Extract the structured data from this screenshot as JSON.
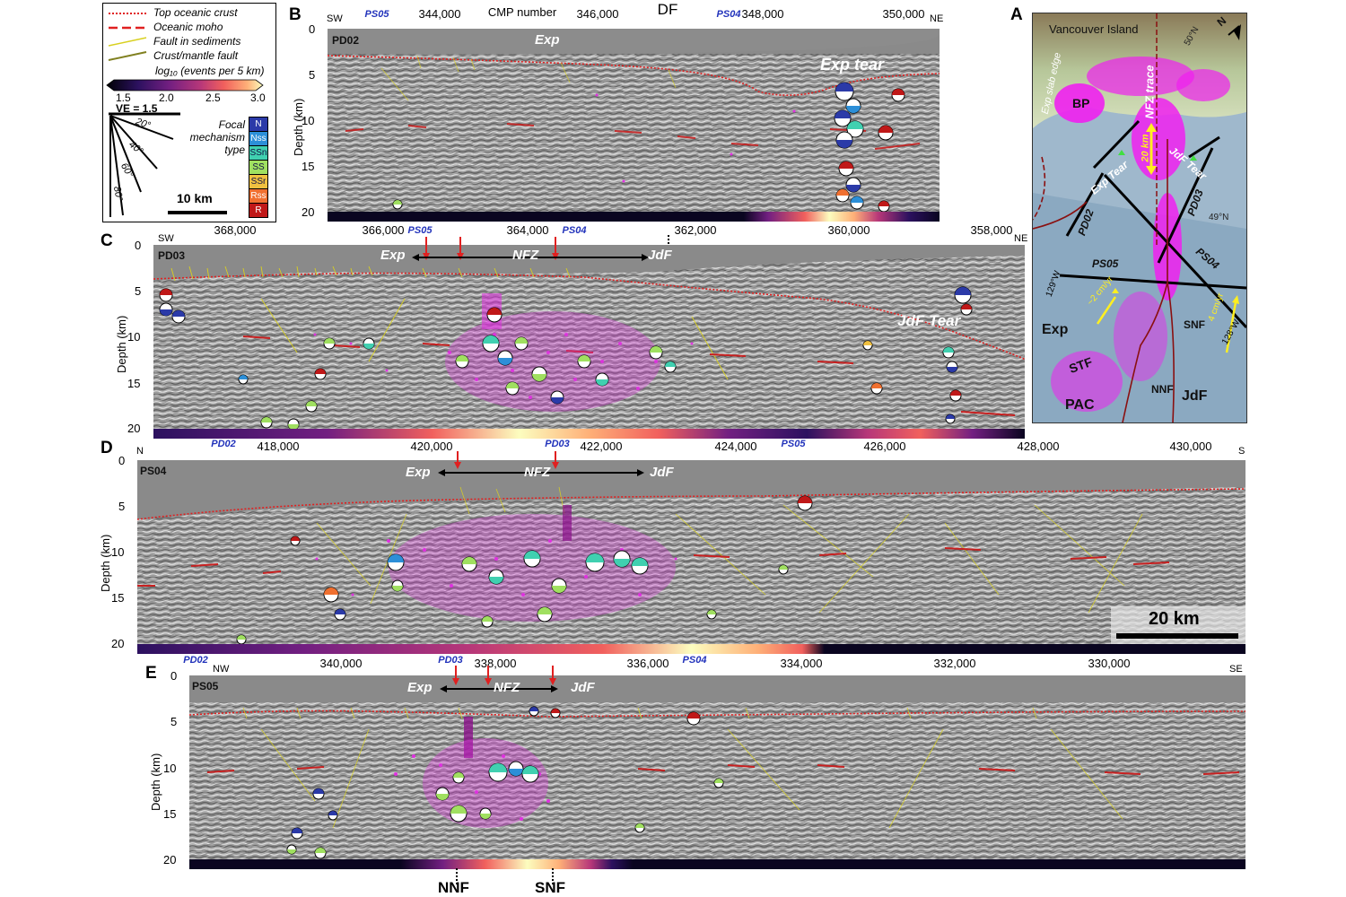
{
  "legend": {
    "items": [
      {
        "label": "Top oceanic crust",
        "color": "#e02020",
        "style": "dotted"
      },
      {
        "label": "Oceanic moho",
        "color": "#e02020",
        "style": "dashed"
      },
      {
        "label": "Fault in sediments",
        "color": "#d8d020",
        "style": "solid"
      },
      {
        "label": "Crust/mantle fault",
        "color": "#808020",
        "style": "solid"
      }
    ],
    "colorbar_title": "log₁₀ (events per 5 km)",
    "colorbar_ticks": [
      "1.5",
      "2.0",
      "2.5",
      "3.0"
    ],
    "ve_label": "VE = 1.5",
    "angle_labels": [
      "20°",
      "40°",
      "60°",
      "80°"
    ],
    "scale_label": "10 km",
    "focal_title": "Focal mechanism type",
    "focal_types": [
      {
        "code": "N",
        "color": "#2b3aa8"
      },
      {
        "code": "Nss",
        "color": "#2c8fd8"
      },
      {
        "code": "SSn",
        "color": "#40d0b0"
      },
      {
        "code": "SS",
        "color": "#a0e060"
      },
      {
        "code": "SSr",
        "color": "#f0c040"
      },
      {
        "code": "Rss",
        "color": "#f07030"
      },
      {
        "code": "R",
        "color": "#c01818"
      }
    ]
  },
  "panelB": {
    "letter": "B",
    "name": "PD02",
    "axis_title": "CMP number",
    "dir_left": "SW",
    "dir_right": "NE",
    "ticks": [
      "344,000",
      "346,000",
      "348,000",
      "350,000"
    ],
    "crossings": [
      "PS05",
      "PS04"
    ],
    "df_label": "DF",
    "labels": [
      "Exp",
      "Exp tear"
    ],
    "depth_ticks": [
      "0",
      "5",
      "10",
      "15",
      "20"
    ],
    "ylabel": "Depth (km)"
  },
  "panelC": {
    "letter": "C",
    "name": "PD03",
    "dir_left": "SW",
    "dir_right": "NE",
    "ticks": [
      "368,000",
      "366,000",
      "364,000",
      "362,000",
      "360,000",
      "358,000"
    ],
    "crossings": [
      "PS05",
      "PS04"
    ],
    "labels": [
      "Exp",
      "NFZ",
      "JdF",
      "JdF Tear"
    ],
    "depth_ticks": [
      "0",
      "5",
      "10",
      "15",
      "20"
    ],
    "ylabel": "Depth (km)"
  },
  "panelD": {
    "letter": "D",
    "name": "PS04",
    "dir_left": "N",
    "dir_right": "S",
    "ticks": [
      "418,000",
      "420,000",
      "422,000",
      "424,000",
      "426,000",
      "428,000",
      "430,000"
    ],
    "crossings": [
      "PD02",
      "PD03",
      "PS05"
    ],
    "labels": [
      "Exp",
      "NFZ",
      "JdF"
    ],
    "scale_label": "20 km",
    "depth_ticks": [
      "0",
      "5",
      "10",
      "15",
      "20"
    ],
    "ylabel": "Depth (km)"
  },
  "panelE": {
    "letter": "E",
    "name": "PS05",
    "dir_left": "NW",
    "dir_right": "SE",
    "ticks": [
      "340,000",
      "338,000",
      "336,000",
      "334,000",
      "332,000",
      "330,000"
    ],
    "crossings": [
      "PD02",
      "PD03",
      "PS04"
    ],
    "labels": [
      "Exp",
      "NFZ",
      "JdF"
    ],
    "bottom_labels": [
      "NNF",
      "SNF"
    ],
    "depth_ticks": [
      "0",
      "5",
      "10",
      "15",
      "20"
    ],
    "ylabel": "Depth (km)"
  },
  "panelA": {
    "letter": "A",
    "labels": {
      "island": "Vancouver Island",
      "bp": "BP",
      "exp_slab": "Exp slab edge",
      "nfz_trace": "NFZ trace",
      "lat50": "50°N",
      "lat49": "49°N",
      "km20": "20 km",
      "jdf_tear": "JdF Tear",
      "exp_tear": "Exp Tear",
      "pd02": "PD02",
      "pd03": "PD03",
      "ps05": "PS05",
      "ps04": "PS04",
      "lon129": "129°W",
      "lon128": "128°W",
      "rate_left": "~2 cm/yr",
      "rate_right": "4 cm/yr",
      "exp": "Exp",
      "snf": "SNF",
      "stf": "STF",
      "nnf": "NNF",
      "pac": "PAC",
      "jdf": "JdF",
      "north": "N"
    }
  }
}
